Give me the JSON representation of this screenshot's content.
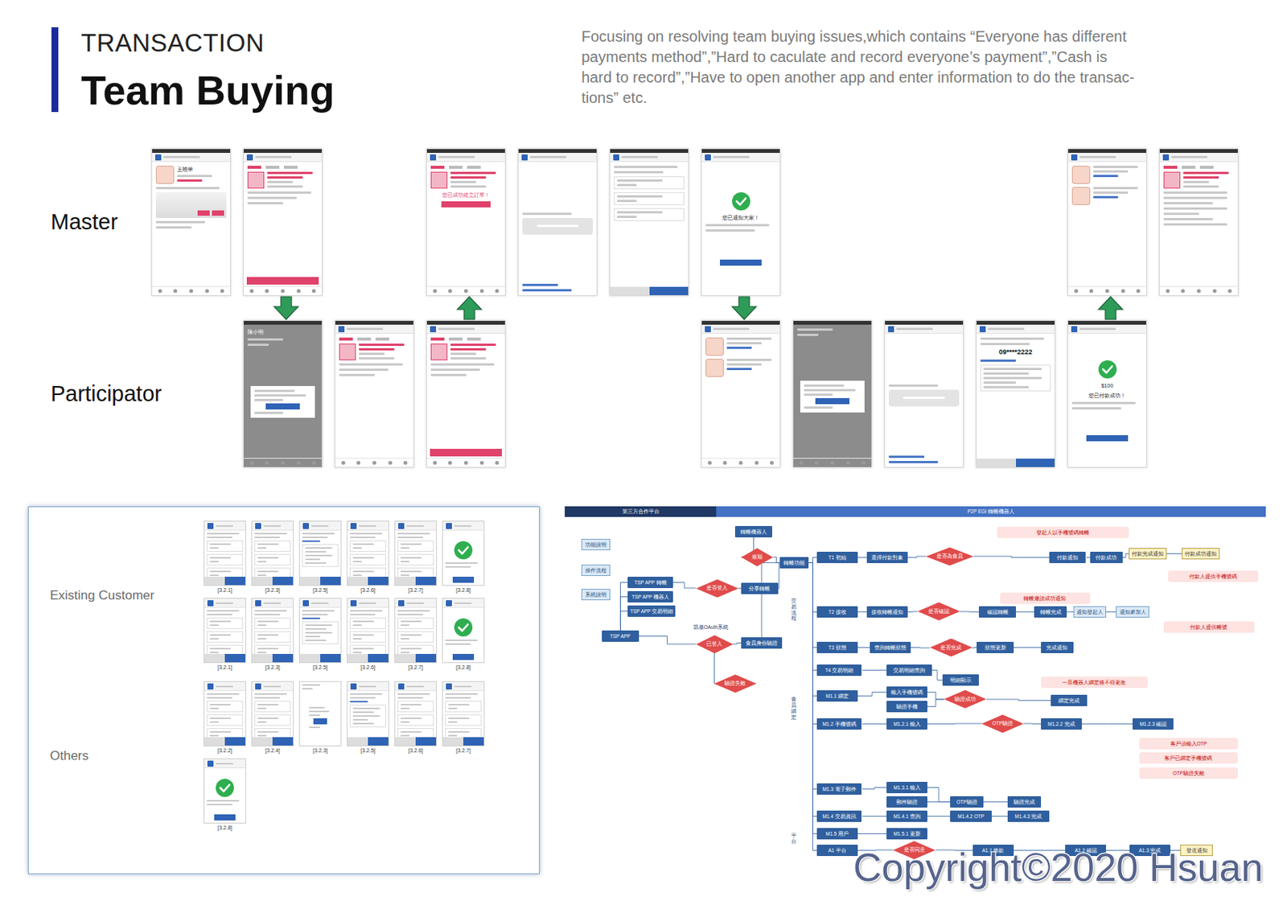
{
  "header": {
    "kicker": "TRANSACTION",
    "title": "Team Buying",
    "description": [
      "Focusing on resolving team buying issues,which contains “Everyone has different",
      "payments method”,”Hard to caculate and record everyone’s payment”,”Cash is",
      "hard to record”,”Have to open another app and enter information to do the transac-",
      "tions” etc."
    ]
  },
  "storyboard": {
    "rows": [
      {
        "label": "Master",
        "phones": [
          {
            "kind": "profile",
            "texts": [
              "王曉華"
            ]
          },
          {
            "kind": "list-buy",
            "texts": []
          },
          {
            "kind": "blank",
            "texts": []
          },
          {
            "kind": "order",
            "texts": [
              "您已成功建立訂單！"
            ]
          },
          {
            "kind": "login",
            "texts": []
          },
          {
            "kind": "form",
            "texts": []
          },
          {
            "kind": "check",
            "texts": [
              "您已通知大家！"
            ]
          },
          {
            "kind": "blank",
            "texts": []
          },
          {
            "kind": "blank",
            "texts": []
          },
          {
            "kind": "blank",
            "texts": []
          },
          {
            "kind": "notify",
            "texts": []
          },
          {
            "kind": "table",
            "texts": []
          }
        ]
      },
      {
        "label": "Participator",
        "phones": [
          {
            "kind": "blank",
            "texts": []
          },
          {
            "kind": "dialog",
            "texts": [
              "陳小明"
            ]
          },
          {
            "kind": "list",
            "texts": []
          },
          {
            "kind": "list-buy",
            "texts": []
          },
          {
            "kind": "blank",
            "texts": []
          },
          {
            "kind": "blank",
            "texts": []
          },
          {
            "kind": "notify",
            "texts": []
          },
          {
            "kind": "dialog",
            "texts": []
          },
          {
            "kind": "login",
            "texts": []
          },
          {
            "kind": "pay",
            "texts": [
              "09****2222"
            ]
          },
          {
            "kind": "check",
            "texts": [
              "$100",
              "您已付款成功！"
            ]
          },
          {
            "kind": "blank",
            "texts": []
          }
        ]
      }
    ],
    "arrows": [
      "none",
      "down",
      "none",
      "up",
      "none",
      "none",
      "down",
      "none",
      "none",
      "none",
      "up",
      "none"
    ]
  },
  "flows": {
    "groups": [
      {
        "label": "Existing Customer",
        "rows": [
          [
            {
              "caption": "[3.2.1]",
              "kind": "form"
            },
            {
              "caption": "[3.2.3]",
              "kind": "form"
            },
            {
              "caption": "[3.2.5]",
              "kind": "pay"
            },
            {
              "caption": "[3.2.6]",
              "kind": "form"
            },
            {
              "caption": "[3.2.7]",
              "kind": "form"
            },
            {
              "caption": "[3.2.8]",
              "kind": "check"
            }
          ],
          [
            {
              "caption": "[3.2.1]",
              "kind": "form"
            },
            {
              "caption": "[3.2.3]",
              "kind": "form"
            },
            {
              "caption": "[3.2.5]",
              "kind": "pay"
            },
            {
              "caption": "[3.2.6]",
              "kind": "form"
            },
            {
              "caption": "[3.2.7]",
              "kind": "form"
            },
            {
              "caption": "[3.2.8]",
              "kind": "check"
            }
          ]
        ]
      },
      {
        "label": "Others",
        "rows": [
          [
            {
              "caption": "[3.2.2]",
              "kind": "form"
            },
            {
              "caption": "[3.2.4]",
              "kind": "form"
            },
            {
              "caption": "[3.2.3]",
              "kind": "dialog"
            },
            {
              "caption": "[3.2.5]",
              "kind": "pay"
            },
            {
              "caption": "[3.2.6]",
              "kind": "form"
            },
            {
              "caption": "[3.2.7]",
              "kind": "form"
            }
          ],
          [
            {
              "caption": "[3.2.8]",
              "kind": "check"
            }
          ]
        ]
      }
    ]
  },
  "flowchart": {
    "header": [
      "第三方合作平台",
      "P2P EGI 轉帳機器人"
    ],
    "vlabels": [
      "交易流程",
      "會員綁定",
      "平台"
    ],
    "nodes": [
      {
        "label": "功能說明",
        "kind": "note"
      },
      {
        "label": "操作流程",
        "kind": "note"
      },
      {
        "label": "系統說明",
        "kind": "note"
      },
      {
        "label": "TSP APP",
        "kind": "box"
      },
      {
        "label": "TSP APP 轉帳",
        "kind": "box"
      },
      {
        "label": "TSP APP 機器人",
        "kind": "box"
      },
      {
        "label": "TSP APP 交易明細",
        "kind": "box"
      },
      {
        "label": "是否登入",
        "kind": "diamond"
      },
      {
        "label": "已登入",
        "kind": "diamond"
      },
      {
        "label": "驗證失敗",
        "kind": "diamond"
      },
      {
        "label": "分享轉帳",
        "kind": "box"
      },
      {
        "label": "會員身份驗證",
        "kind": "box"
      },
      {
        "label": "轉帳機器人",
        "kind": "box"
      },
      {
        "label": "逾期",
        "kind": "diamond"
      },
      {
        "label": "轉帳功能",
        "kind": "box"
      },
      {
        "label": "T1 初始",
        "kind": "box"
      },
      {
        "label": "選擇付款對象",
        "kind": "box"
      },
      {
        "label": "是否為會員",
        "kind": "diamond"
      },
      {
        "label": "付款通知",
        "kind": "box"
      },
      {
        "label": "付款成功",
        "kind": "box"
      },
      {
        "label": "付款完成通知",
        "kind": "yellow"
      },
      {
        "label": "付款成功通知",
        "kind": "yellow"
      },
      {
        "label": "T2 接收",
        "kind": "box"
      },
      {
        "label": "接收轉帳通知",
        "kind": "box"
      },
      {
        "label": "是否確認",
        "kind": "diamond"
      },
      {
        "label": "確認轉帳",
        "kind": "box"
      },
      {
        "label": "轉帳完成",
        "kind": "box"
      },
      {
        "label": "通知發起人",
        "kind": "note"
      },
      {
        "label": "通知參加人",
        "kind": "note"
      },
      {
        "label": "T3 狀態",
        "kind": "box"
      },
      {
        "label": "查詢轉帳狀態",
        "kind": "box"
      },
      {
        "label": "是否完成",
        "kind": "diamond"
      },
      {
        "label": "狀態更新",
        "kind": "box"
      },
      {
        "label": "完成通知",
        "kind": "box"
      },
      {
        "label": "T4 交易明細",
        "kind": "box"
      },
      {
        "label": "交易明細查詢",
        "kind": "box"
      },
      {
        "label": "明細顯示",
        "kind": "box"
      },
      {
        "label": "M1.1 綁定",
        "kind": "box"
      },
      {
        "label": "輸入手機號碼",
        "kind": "box"
      },
      {
        "label": "驗證手機",
        "kind": "box"
      },
      {
        "label": "驗證成功",
        "kind": "diamond"
      },
      {
        "label": "綁定完成",
        "kind": "box"
      },
      {
        "label": "M1.2 手機號碼",
        "kind": "box"
      },
      {
        "label": "M1.2.1 輸入",
        "kind": "box"
      },
      {
        "label": "OTP驗證",
        "kind": "diamond"
      },
      {
        "label": "M1.2.2 完成",
        "kind": "box"
      },
      {
        "label": "M1.2.3 確認",
        "kind": "box"
      },
      {
        "label": "M1.3 電子郵件",
        "kind": "box"
      },
      {
        "label": "M1.3.1 輸入",
        "kind": "box"
      },
      {
        "label": "郵件驗證",
        "kind": "box"
      },
      {
        "label": "OTP驗證",
        "kind": "box"
      },
      {
        "label": "驗證完成",
        "kind": "box"
      },
      {
        "label": "M1.4 交易資訊",
        "kind": "box"
      },
      {
        "label": "M1.4.1 查詢",
        "kind": "box"
      },
      {
        "label": "M1.4.2 OTP",
        "kind": "box"
      },
      {
        "label": "M1.4.3 完成",
        "kind": "box"
      },
      {
        "label": "M1.5 用戶",
        "kind": "box"
      },
      {
        "label": "M1.5.1 更新",
        "kind": "box"
      },
      {
        "label": "A1 平台",
        "kind": "box"
      },
      {
        "label": "是否同意",
        "kind": "diamond"
      },
      {
        "label": "A1.1 條款",
        "kind": "box"
      },
      {
        "label": "A1.2 確認",
        "kind": "box"
      },
      {
        "label": "A1.3 完成",
        "kind": "box"
      },
      {
        "label": "發送通知",
        "kind": "yellow"
      },
      {
        "label": "發起人以手機號碼轉帳",
        "kind": "red"
      },
      {
        "label": "付款人提供手機號碼",
        "kind": "red"
      },
      {
        "label": "轉帳邀請成功通知",
        "kind": "red"
      },
      {
        "label": "付款人提供帳號",
        "kind": "red"
      },
      {
        "label": "一旦機器人綁定後不得更改",
        "kind": "red"
      },
      {
        "label": "客戶須輸入OTP",
        "kind": "red"
      },
      {
        "label": "客戶已綁定手機號碼",
        "kind": "red"
      },
      {
        "label": "OTP驗證失敗",
        "kind": "red"
      },
      {
        "label": "凱基OAuth系統",
        "kind": "plain"
      }
    ],
    "edges": [
      [
        3,
        4
      ],
      [
        3,
        5
      ],
      [
        3,
        6
      ],
      [
        4,
        7
      ],
      [
        7,
        10
      ],
      [
        10,
        14
      ],
      [
        3,
        8
      ],
      [
        8,
        11
      ],
      [
        11,
        14
      ],
      [
        8,
        9
      ],
      [
        12,
        13
      ],
      [
        13,
        14
      ],
      [
        15,
        16
      ],
      [
        16,
        17
      ],
      [
        17,
        18
      ],
      [
        18,
        19
      ],
      [
        19,
        20
      ],
      [
        20,
        21
      ],
      [
        22,
        23
      ],
      [
        23,
        24
      ],
      [
        24,
        25
      ],
      [
        25,
        26
      ],
      [
        26,
        27
      ],
      [
        27,
        28
      ],
      [
        29,
        30
      ],
      [
        30,
        31
      ],
      [
        31,
        32
      ],
      [
        32,
        33
      ],
      [
        34,
        35
      ],
      [
        35,
        36
      ],
      [
        37,
        38
      ],
      [
        38,
        40
      ],
      [
        39,
        40
      ],
      [
        40,
        41
      ],
      [
        42,
        43
      ],
      [
        43,
        44
      ],
      [
        44,
        45
      ],
      [
        45,
        46
      ],
      [
        47,
        48
      ],
      [
        48,
        50
      ],
      [
        49,
        50
      ],
      [
        50,
        51
      ],
      [
        52,
        53
      ],
      [
        53,
        54
      ],
      [
        54,
        55
      ],
      [
        56,
        57
      ],
      [
        58,
        59
      ],
      [
        59,
        60
      ],
      [
        60,
        61
      ],
      [
        61,
        62
      ],
      [
        62,
        63
      ],
      [
        14,
        15
      ],
      [
        14,
        22
      ],
      [
        14,
        29
      ],
      [
        14,
        34
      ],
      [
        14,
        37
      ],
      [
        14,
        42
      ],
      [
        14,
        47
      ],
      [
        14,
        52
      ],
      [
        14,
        56
      ],
      [
        14,
        58
      ]
    ]
  },
  "watermark": "Copyright©2020 Hsuan"
}
